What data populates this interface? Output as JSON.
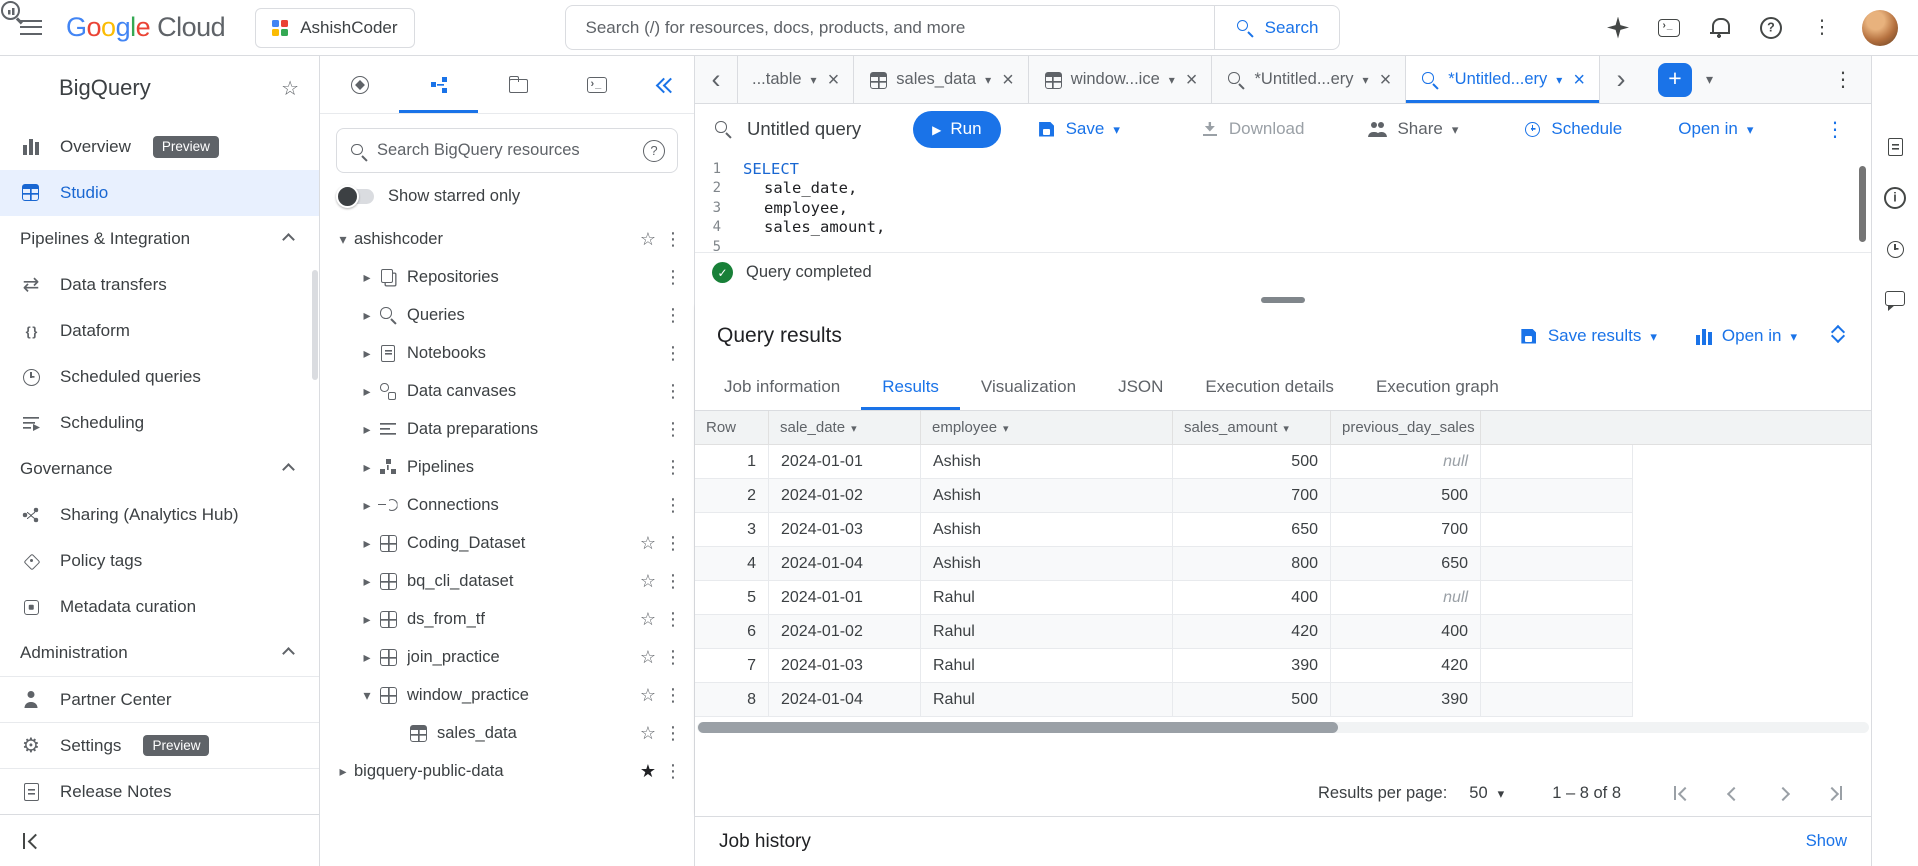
{
  "topbar": {
    "google_letters": [
      "G",
      "o",
      "o",
      "g",
      "l",
      "e"
    ],
    "logo_cloud": "Cloud",
    "project_name": "AshishCoder",
    "search_placeholder": "Search (/) for resources, docs, products, and more",
    "search_button": "Search"
  },
  "left_nav": {
    "title": "BigQuery",
    "overview": "Overview",
    "overview_badge": "Preview",
    "studio": "Studio",
    "sections": {
      "pipelines": "Pipelines & Integration",
      "governance": "Governance",
      "administration": "Administration"
    },
    "items": {
      "data_transfers": "Data transfers",
      "dataform": "Dataform",
      "scheduled_queries": "Scheduled queries",
      "scheduling": "Scheduling",
      "sharing": "Sharing (Analytics Hub)",
      "policy_tags": "Policy tags",
      "metadata_curation": "Metadata curation",
      "partner_center": "Partner Center",
      "settings": "Settings",
      "settings_badge": "Preview",
      "release_notes": "Release Notes"
    }
  },
  "explorer": {
    "search_placeholder": "Search BigQuery resources",
    "starred_toggle": "Show starred only",
    "tree": [
      {
        "label": "ashishcoder",
        "level": "0",
        "expanded": true,
        "star_outline": true
      },
      {
        "label": "Repositories",
        "level": "1",
        "collapsed": true,
        "icon": "repositories-icon"
      },
      {
        "label": "Queries",
        "level": "1",
        "collapsed": true,
        "icon": "queries-icon"
      },
      {
        "label": "Notebooks",
        "level": "1",
        "collapsed": true,
        "icon": "notebooks-icon"
      },
      {
        "label": "Data canvases",
        "level": "1",
        "collapsed": true,
        "icon": "data-canvases-icon"
      },
      {
        "label": "Data preparations",
        "level": "1",
        "collapsed": true,
        "icon": "data-preparations-icon"
      },
      {
        "label": "Pipelines",
        "level": "1",
        "collapsed": true,
        "icon": "pipelines-icon"
      },
      {
        "label": "Connections",
        "level": "1",
        "collapsed": true,
        "icon": "connections-icon"
      },
      {
        "label": "Coding_Dataset",
        "level": "1",
        "collapsed": true,
        "icon": "dataset-icon",
        "star_outline": true
      },
      {
        "label": "bq_cli_dataset",
        "level": "1",
        "collapsed": true,
        "icon": "dataset-icon",
        "star_outline": true
      },
      {
        "label": "ds_from_tf",
        "level": "1",
        "collapsed": true,
        "icon": "dataset-icon",
        "star_outline": true
      },
      {
        "label": "join_practice",
        "level": "1",
        "collapsed": true,
        "icon": "dataset-icon",
        "star_outline": true
      },
      {
        "label": "window_practice",
        "level": "1",
        "expanded": true,
        "icon": "dataset-icon",
        "star_outline": true
      },
      {
        "label": "sales_data",
        "level": "2",
        "icon": "table-icon",
        "star_outline": true
      },
      {
        "label": "bigquery-public-data",
        "level": "0",
        "collapsed": true,
        "star_filled": true
      }
    ]
  },
  "tabs": {
    "items": [
      {
        "label": "...table",
        "caret": true
      },
      {
        "label": "sales_data",
        "icon_table": true,
        "caret": true
      },
      {
        "label": "window...ice",
        "icon_table": true,
        "caret": true
      },
      {
        "label": "*Untitled...ery",
        "icon_query": true,
        "caret": true
      },
      {
        "label": "*Untitled...ery",
        "icon_query": true,
        "caret": true,
        "active": true
      }
    ]
  },
  "editor": {
    "title": "Untitled query",
    "run": "Run",
    "save": "Save",
    "download": "Download",
    "share": "Share",
    "schedule": "Schedule",
    "open_in": "Open in",
    "code_lines": [
      {
        "n": "1",
        "text": "SELECT",
        "keyword": true
      },
      {
        "n": "2",
        "text": "sale_date,",
        "indent": true
      },
      {
        "n": "3",
        "text": "employee,",
        "indent": true
      },
      {
        "n": "4",
        "text": "sales_amount,",
        "indent": true
      },
      {
        "n": "5",
        "text": ""
      }
    ],
    "status": "Query completed"
  },
  "results": {
    "title": "Query results",
    "save_results": "Save results",
    "open_in": "Open in",
    "tabs": [
      {
        "label": "Job information"
      },
      {
        "label": "Results",
        "active": true
      },
      {
        "label": "Visualization"
      },
      {
        "label": "JSON"
      },
      {
        "label": "Execution details"
      },
      {
        "label": "Execution graph"
      }
    ],
    "columns": [
      "Row",
      "sale_date",
      "employee",
      "sales_amount",
      "previous_day_sales"
    ],
    "rows": [
      {
        "n": "1",
        "sale_date": "2024-01-01",
        "employee": "Ashish",
        "sales_amount": "500",
        "previous_day_sales": "null",
        "prev_null": true
      },
      {
        "n": "2",
        "sale_date": "2024-01-02",
        "employee": "Ashish",
        "sales_amount": "700",
        "previous_day_sales": "500"
      },
      {
        "n": "3",
        "sale_date": "2024-01-03",
        "employee": "Ashish",
        "sales_amount": "650",
        "previous_day_sales": "700"
      },
      {
        "n": "4",
        "sale_date": "2024-01-04",
        "employee": "Ashish",
        "sales_amount": "800",
        "previous_day_sales": "650"
      },
      {
        "n": "5",
        "sale_date": "2024-01-01",
        "employee": "Rahul",
        "sales_amount": "400",
        "previous_day_sales": "null",
        "prev_null": true
      },
      {
        "n": "6",
        "sale_date": "2024-01-02",
        "employee": "Rahul",
        "sales_amount": "420",
        "previous_day_sales": "400"
      },
      {
        "n": "7",
        "sale_date": "2024-01-03",
        "employee": "Rahul",
        "sales_amount": "390",
        "previous_day_sales": "420"
      },
      {
        "n": "8",
        "sale_date": "2024-01-04",
        "employee": "Rahul",
        "sales_amount": "500",
        "previous_day_sales": "390"
      }
    ],
    "per_page_label": "Results per page:",
    "per_page_value": "50",
    "range": "1 – 8 of 8"
  },
  "job_history": {
    "title": "Job history",
    "action": "Show"
  },
  "colors": {
    "accent": "#1a73e8",
    "active_nav_bg": "#e8f0fe",
    "keyword_blue": "#1967d2",
    "success_green": "#188038"
  }
}
